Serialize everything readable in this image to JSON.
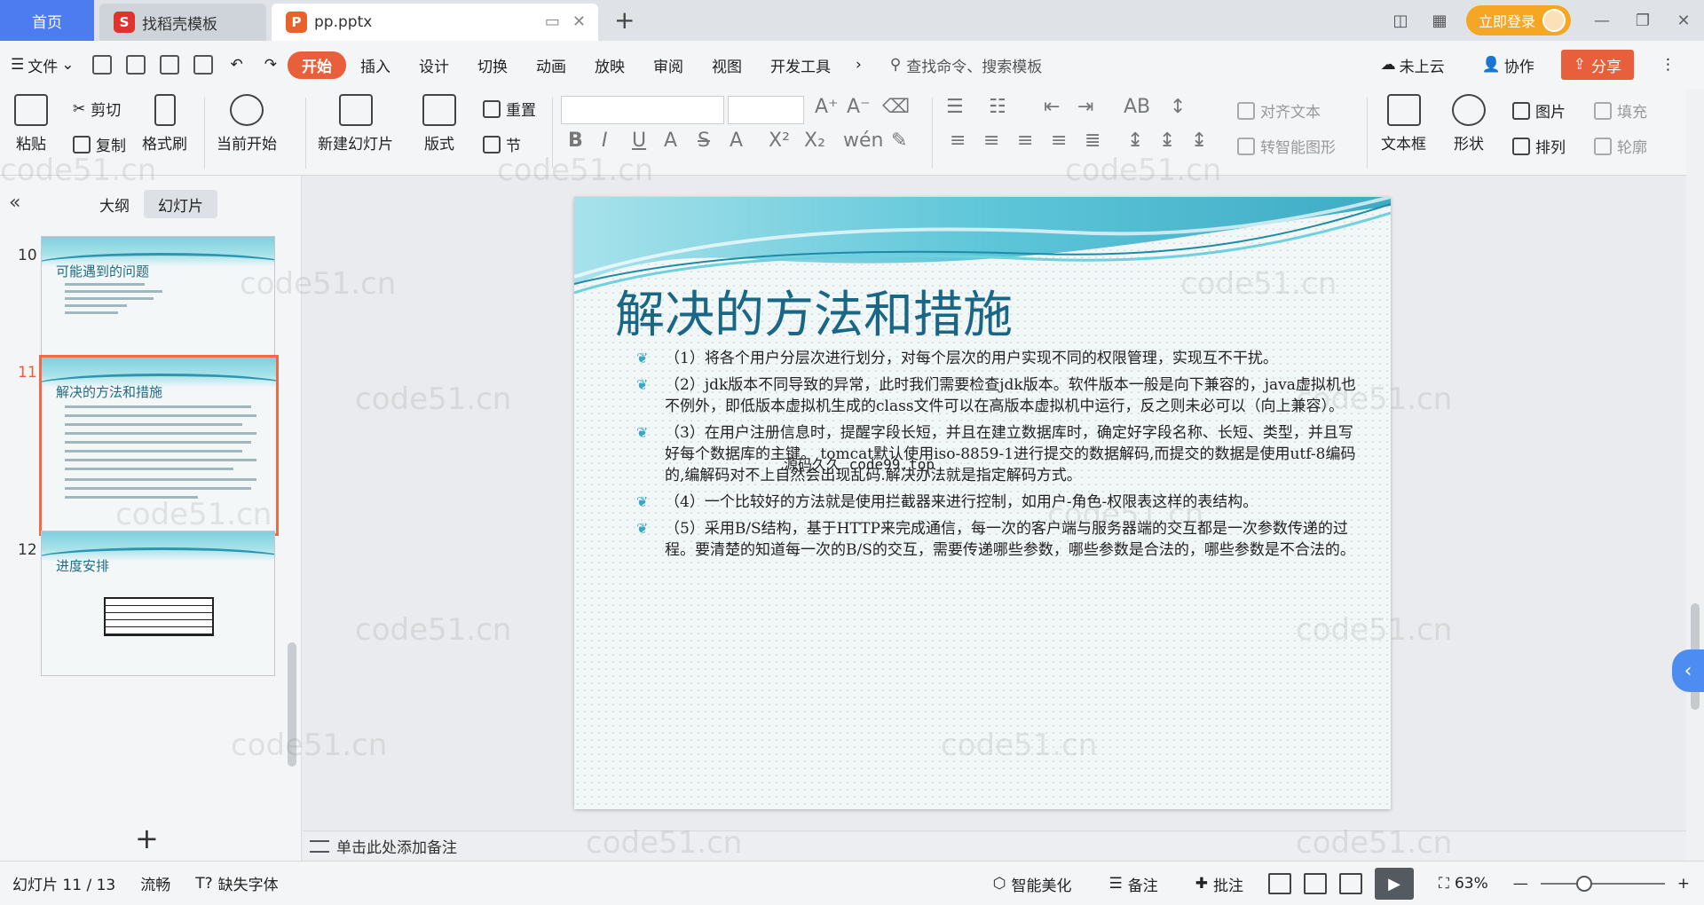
{
  "tabbar": {
    "home": "首页",
    "docer_tab": "找稻壳模板",
    "doc_tab": "pp.pptx",
    "login": "立即登录"
  },
  "menubar": {
    "file": "文件",
    "tabs": [
      "开始",
      "插入",
      "设计",
      "切换",
      "动画",
      "放映",
      "审阅",
      "视图",
      "开发工具"
    ],
    "search": "查找命令、搜索模板",
    "cloud": "未上云",
    "collab": "协作",
    "share": "分享"
  },
  "ribbon": {
    "paste": "粘贴",
    "cut": "剪切",
    "copy": "复制",
    "format_painter": "格式刷",
    "from_current": "当前开始",
    "new_slide": "新建幻灯片",
    "layout": "版式",
    "reset": "重置",
    "section": "节",
    "align_text": "对齐文本",
    "smartart": "转智能图形",
    "textbox": "文本框",
    "shape": "形状",
    "picture": "图片",
    "arrange": "排列",
    "fill": "填充",
    "outline": "轮廓"
  },
  "leftpanel": {
    "tab_outline": "大纲",
    "tab_slides": "幻灯片",
    "thumbs": [
      {
        "num": "10",
        "title": "可能遇到的问题"
      },
      {
        "num": "11",
        "title": "解决的方法和措施"
      },
      {
        "num": "12",
        "title": "进度安排"
      }
    ]
  },
  "slide": {
    "title": "解决的方法和措施",
    "bullets": [
      "（1）将各个用户分层次进行划分，对每个层次的用户实现不同的权限管理，实现互不干扰。",
      "（2）jdk版本不同导致的异常，此时我们需要检查jdk版本。软件版本一般是向下兼容的，java虚拟机也不例外，即低版本虚拟机生成的class文件可以在高版本虚拟机中运行，反之则未必可以（向上兼容）。",
      "（3）在用户注册信息时，提醒字段长短，并且在建立数据库时，确定好字段名称、长短、类型，并且写好每个数据库的主键。 tomcat默认使用iso-8859-1进行提交的数据解码,而提交的数据是使用utf-8编码的,编解码对不上自然会出现乱码.解决办法就是指定解码方式。",
      "（4）一个比较好的方法就是使用拦截器来进行控制，如用户-角色-权限表这样的表结构。",
      "（5）采用B/S结构，基于HTTP来完成通信，每一次的客户端与服务器端的交互都是一次参数传递的过程。要清楚的知道每一次的B/S的交互，需要传递哪些参数，哪些参数是合法的，哪些参数是不合法的。"
    ],
    "overlay": "源码久久 code99.top"
  },
  "notes": "单击此处添加备注",
  "statusbar": {
    "slide_info": "幻灯片 11 / 13",
    "smooth": "流畅",
    "missing_font": "缺失字体",
    "beautify": "智能美化",
    "notes": "备注",
    "comment": "批注",
    "zoom": "63%"
  },
  "watermark": "code51.cn",
  "colors": {
    "accent": "#e7603b",
    "title": "#1a6685",
    "home_tab": "#4d7cf0"
  }
}
